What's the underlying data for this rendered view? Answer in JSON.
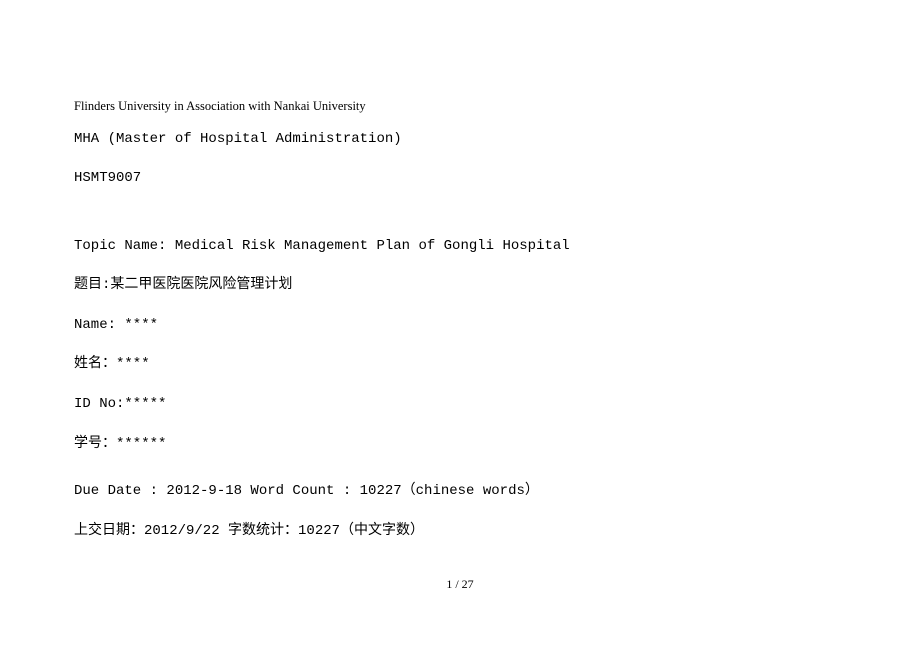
{
  "header": {
    "university": "Flinders University in Association with Nankai University",
    "program": "MHA (Master of Hospital Administration)",
    "course_code": "HSMT9007"
  },
  "topic": {
    "en_label_value": "Topic Name: Medical Risk Management Plan of Gongli Hospital",
    "cn_label_value": "题目:某二甲医院医院风险管理计划"
  },
  "name": {
    "en": "Name: ****",
    "cn": "姓名：****"
  },
  "id_no": {
    "en": "ID No:*****",
    "cn": "学号：******"
  },
  "due": {
    "en": "Due Date : 2012-9-18      Word Count : 10227（chinese words）",
    "cn": "上交日期：2012/9/22      字数统计：10227（中文字数）"
  },
  "page_number": "1 / 27"
}
